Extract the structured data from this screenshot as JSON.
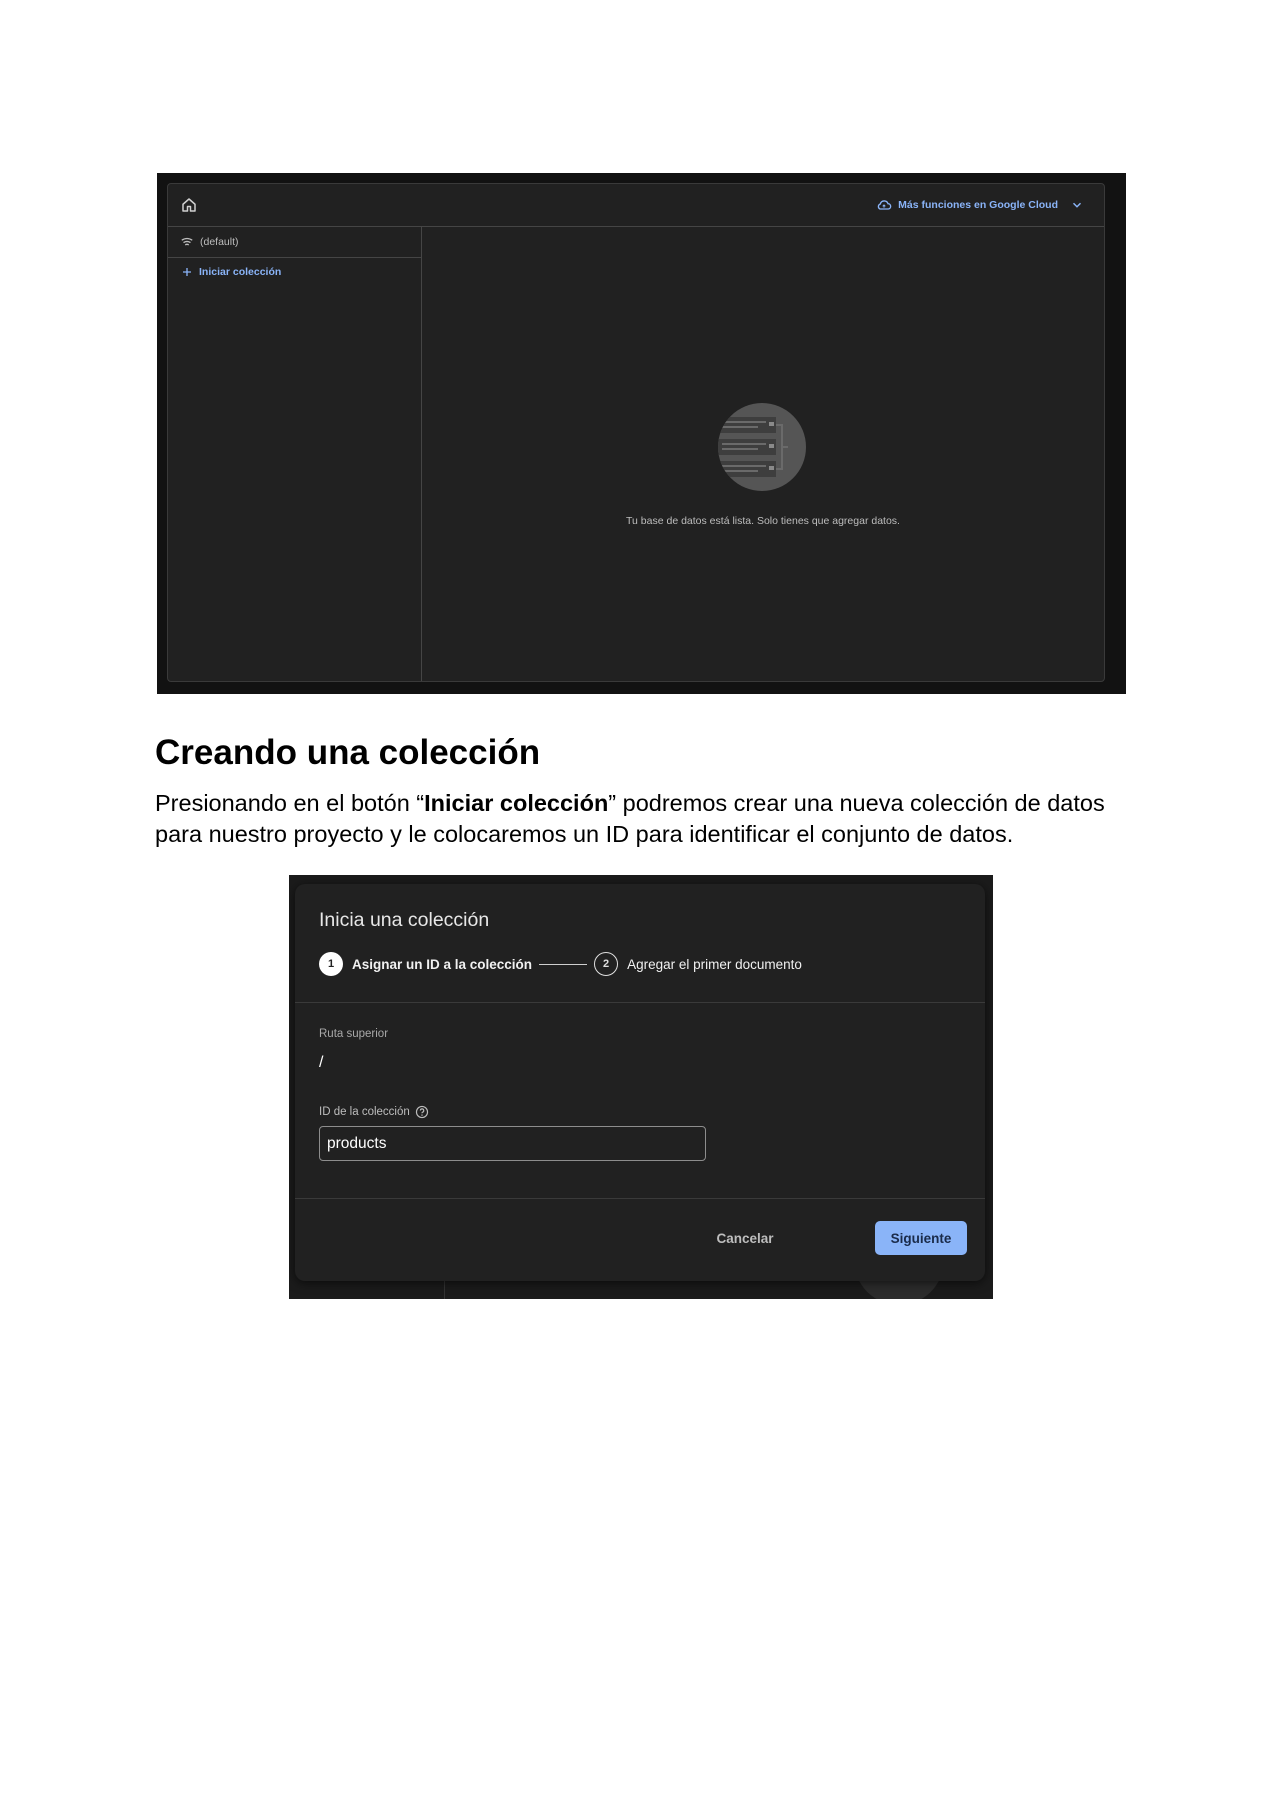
{
  "console_screenshot": {
    "home_icon": "home-icon",
    "cloud_link": {
      "icon": "cloud-icon",
      "label": "Más funciones en Google Cloud",
      "chevron": "chevron-down-icon"
    },
    "database": {
      "icon": "database-icon",
      "label": "(default)"
    },
    "start_collection": {
      "icon": "plus-icon",
      "label": "Iniciar colección"
    },
    "empty_state": {
      "illustration": "database-illustration",
      "message": "Tu base de datos está lista. Solo tienes que agregar datos."
    },
    "colors": {
      "accent": "#8ab4f8",
      "panel": "#212121",
      "frame": "#121212"
    }
  },
  "document": {
    "heading": "Creando una colección",
    "paragraph": {
      "before": "Presionando en el botón “",
      "bold": "Iniciar colección",
      "after": "” podremos crear una nueva colección de datos para nuestro proyecto y le colocaremos un ID para identificar el conjunto de datos."
    }
  },
  "dialog_screenshot": {
    "title": "Inicia una colección",
    "steps": [
      {
        "number": "1",
        "label": "Asignar un ID a la colección",
        "active": true
      },
      {
        "number": "2",
        "label": "Agregar el primer documento",
        "active": false
      }
    ],
    "parent_path": {
      "label": "Ruta superior",
      "value": "/"
    },
    "collection_id": {
      "label": "ID de la colección",
      "help_icon": "help-icon",
      "value": "products"
    },
    "buttons": {
      "cancel": "Cancelar",
      "next": "Siguiente"
    },
    "colors": {
      "primary_button": "#8ab4f8",
      "dialog": "#212121"
    }
  }
}
